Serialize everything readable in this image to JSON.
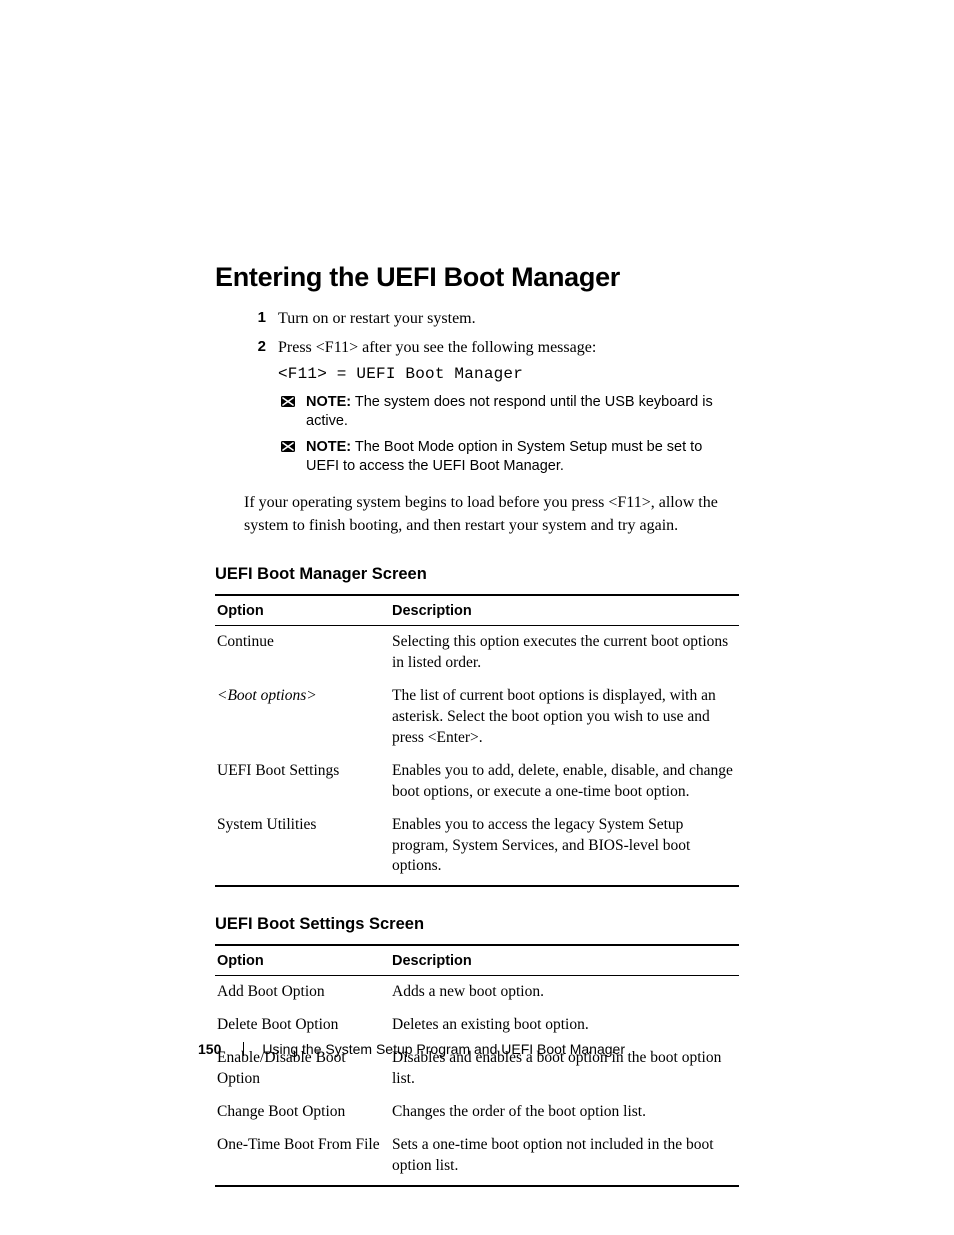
{
  "title": "Entering the UEFI Boot Manager",
  "steps": [
    {
      "num": "1",
      "text": "Turn on or restart your system."
    },
    {
      "num": "2",
      "text": "Press <F11> after you see the following message:"
    }
  ],
  "code_line": "<F11> = UEFI Boot Manager",
  "note_label": "NOTE:",
  "notes": [
    "The system does not respond until the USB keyboard is active.",
    "The Boot Mode option in System Setup must be set to UEFI to access the UEFI Boot Manager."
  ],
  "post_para": "If your operating system begins to load before you press <F11>, allow the system to finish booting, and then restart your system and try again.",
  "table1": {
    "heading": "UEFI Boot Manager Screen",
    "col1": "Option",
    "col2": "Description",
    "rows": [
      {
        "opt": "Continue",
        "desc": "Selecting this option executes the current boot options in listed order."
      },
      {
        "opt": "<Boot options>",
        "italic": true,
        "desc": "The list of current boot options is displayed, with an asterisk. Select the boot option you wish to use and press <Enter>."
      },
      {
        "opt": "UEFI Boot Settings",
        "desc": "Enables you to add, delete, enable, disable, and change boot options, or execute a one-time boot option."
      },
      {
        "opt": "System Utilities",
        "desc": "Enables you to access the legacy System Setup program, System Services, and BIOS-level boot options."
      }
    ]
  },
  "table2": {
    "heading": "UEFI Boot Settings Screen",
    "col1": "Option",
    "col2": "Description",
    "rows": [
      {
        "opt": "Add Boot Option",
        "desc": "Adds a new boot option."
      },
      {
        "opt": "Delete Boot Option",
        "desc": "Deletes an existing boot option."
      },
      {
        "opt": "Enable/Disable Boot Option",
        "desc": "Disables and enables a boot option in the boot option list."
      },
      {
        "opt": "Change Boot Option",
        "desc": "Changes the order of the boot option list."
      },
      {
        "opt": "One-Time Boot From File",
        "desc": "Sets a one-time boot option not included in the boot option list."
      }
    ]
  },
  "footer": {
    "page": "150",
    "chapter": "Using the System Setup Program and UEFI Boot Manager"
  }
}
